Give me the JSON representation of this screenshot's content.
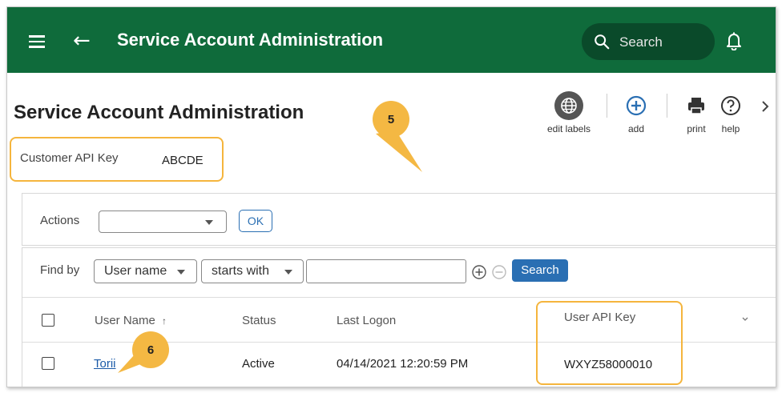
{
  "topbar": {
    "title": "Service Account Administration",
    "search_label": "Search"
  },
  "page": {
    "title": "Service Account Administration",
    "customer_api_key_label": "Customer API Key",
    "customer_api_key_value": "ABCDE"
  },
  "toolbar": {
    "edit_labels": "edit labels",
    "add": "add",
    "print": "print",
    "help": "help"
  },
  "callouts": {
    "five": "5",
    "six": "6"
  },
  "actions": {
    "label": "Actions",
    "selected": "",
    "ok_label": "OK"
  },
  "find": {
    "label": "Find by",
    "field": "User name",
    "operator": "starts with",
    "value": "",
    "search_label": "Search"
  },
  "table": {
    "headers": {
      "user_name": "User Name",
      "sort_indicator": "↑",
      "status": "Status",
      "last_logon": "Last Logon",
      "user_api_key": "User API Key"
    },
    "rows": [
      {
        "user_name": "Torii",
        "status": "Active",
        "last_logon": "04/14/2021 12:20:59 PM",
        "user_api_key": "WXYZ58000010"
      }
    ]
  },
  "colors": {
    "topbar": "#0f6b3b",
    "accent_blue": "#2a6fb3",
    "highlight": "#f5b53d"
  }
}
